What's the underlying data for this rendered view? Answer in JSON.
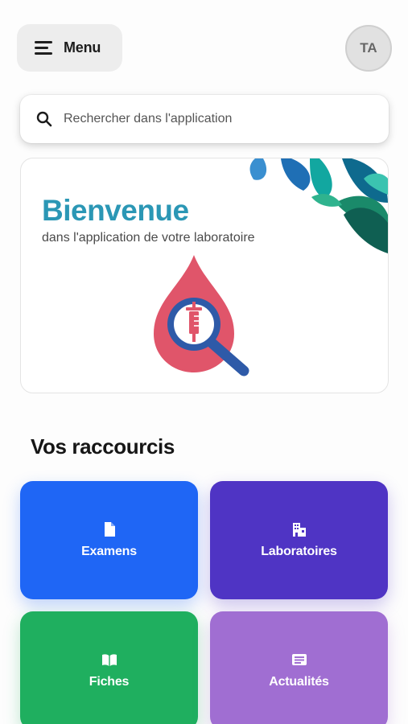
{
  "header": {
    "menu_label": "Menu",
    "avatar_initials": "TA"
  },
  "search": {
    "placeholder": "Rechercher dans l'application"
  },
  "welcome": {
    "title": "Bienvenue",
    "subtitle": "dans l'application de votre laboratoire"
  },
  "shortcuts": {
    "title": "Vos raccourcis",
    "items": [
      {
        "label": "Examens",
        "icon": "document-icon",
        "color": "#1f66f5"
      },
      {
        "label": "Laboratoires",
        "icon": "building-icon",
        "color": "#4f34c4"
      },
      {
        "label": "Fiches",
        "icon": "book-icon",
        "color": "#1faf5f"
      },
      {
        "label": "Actualités",
        "icon": "news-icon",
        "color": "#a06ed2"
      }
    ]
  },
  "colors": {
    "accent_title": "#2b97b5",
    "drop_red": "#e0556a",
    "magnifier_blue": "#2e5aa8"
  }
}
